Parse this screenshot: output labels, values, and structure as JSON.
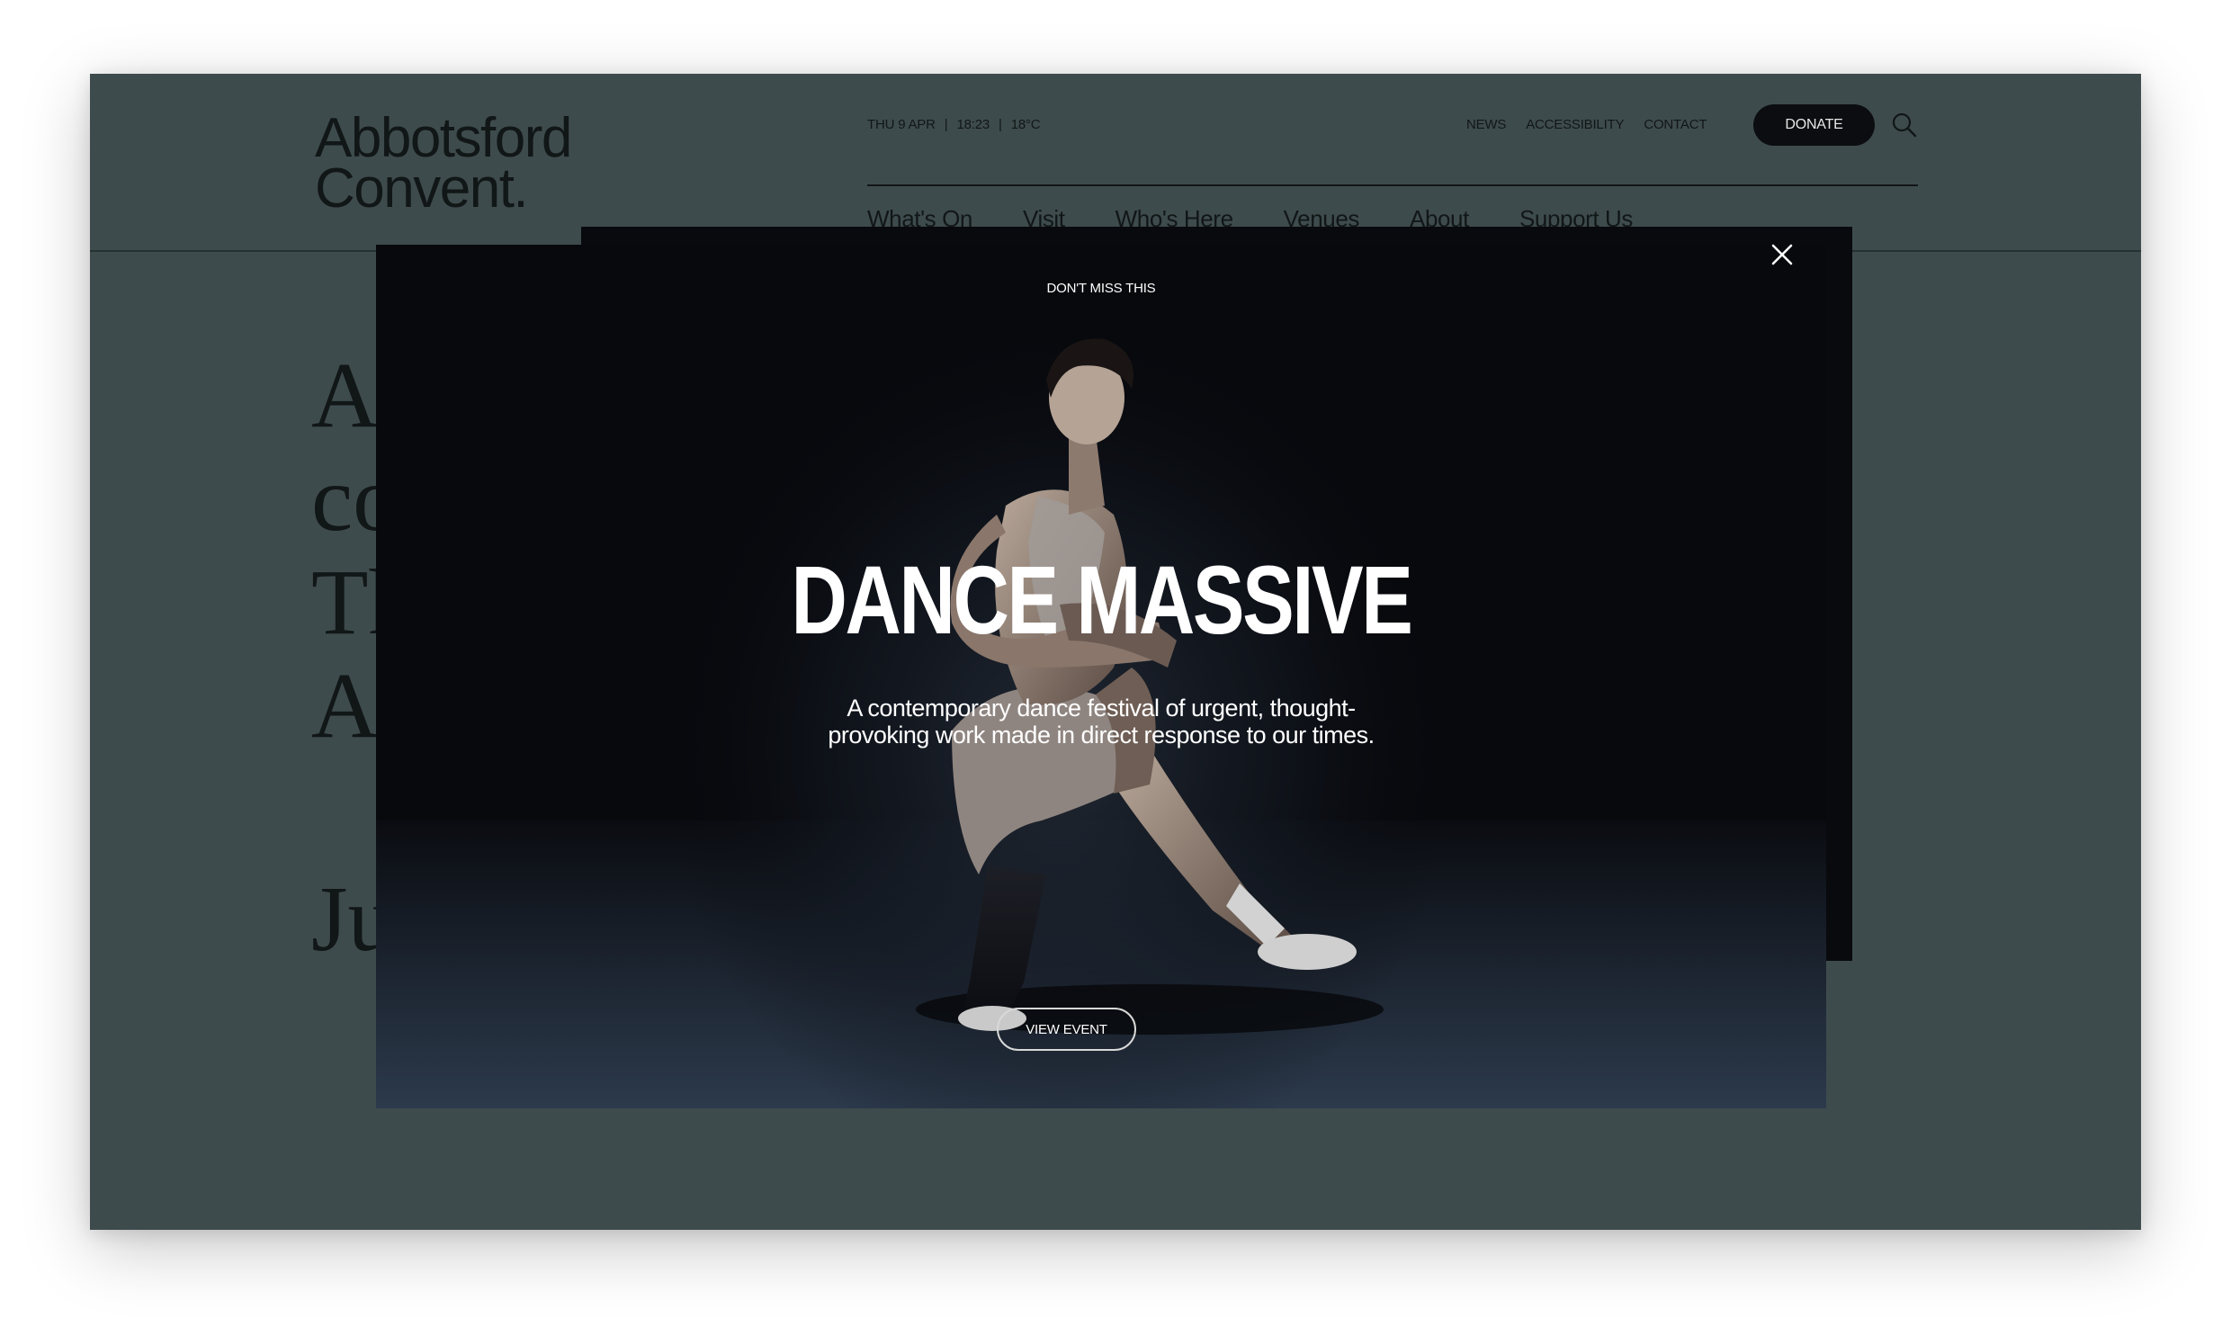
{
  "header": {
    "logo_line1": "Abbotsford",
    "logo_line2": "Convent.",
    "meta": {
      "date": "THU 9 APR",
      "separator": "|",
      "time": "18:23",
      "temp": "18°C"
    },
    "utility_nav": [
      "NEWS",
      "ACCESSIBILITY",
      "CONTACT"
    ],
    "donate_label": "DONATE",
    "main_nav": [
      "What's On",
      "Visit",
      "Who's Here",
      "Venues",
      "About",
      "Support Us"
    ]
  },
  "background_text": {
    "line1": "A",
    "line2": "co",
    "line3": "Th",
    "line4": "A",
    "line5": "Ju"
  },
  "modal": {
    "eyebrow": "DON'T MISS THIS",
    "title": "DANCE MASSIVE",
    "description_line1": "A contemporary dance festival of urgent, thought-",
    "description_line2": "provoking work made in direct response to our times.",
    "cta_label": "VIEW EVENT"
  },
  "colors": {
    "page_bg": "#3e4b4c",
    "modal_bg": "#090a0e",
    "text_dark": "#111617",
    "text_light": "#ffffff"
  },
  "icons": {
    "search": "search-icon",
    "close": "close-icon"
  }
}
